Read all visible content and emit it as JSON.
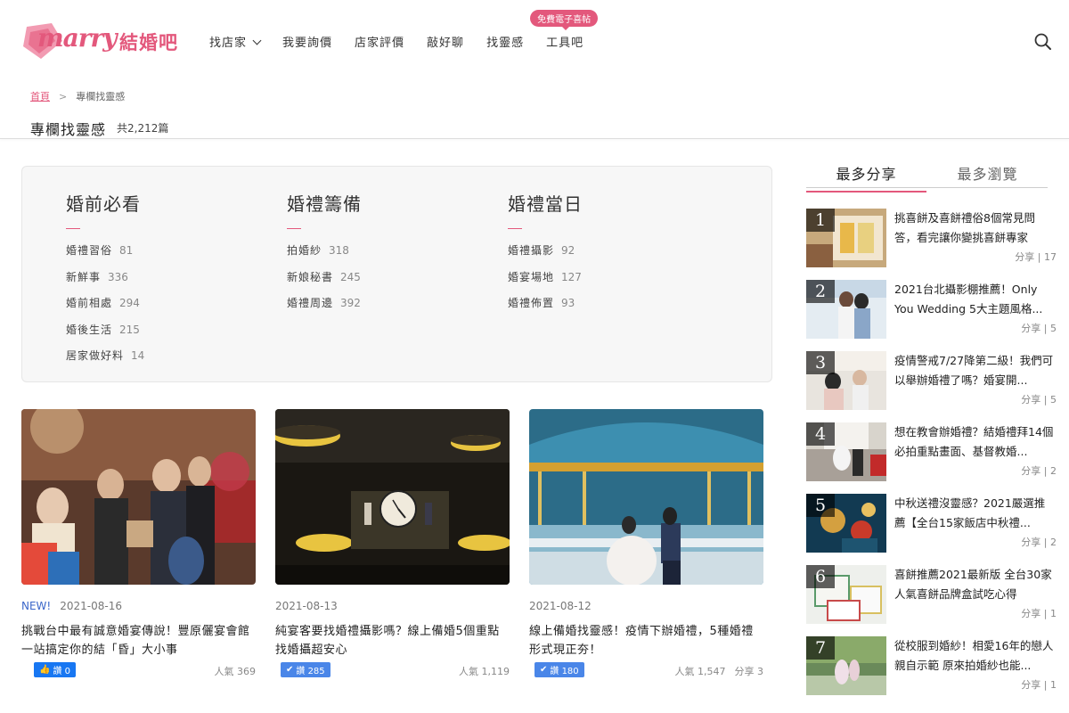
{
  "header": {
    "logo_script": "marry",
    "logo_cn": "結婚吧",
    "nav": [
      {
        "label": "找店家",
        "has_dropdown": true
      },
      {
        "label": "我要詢價"
      },
      {
        "label": "店家評價"
      },
      {
        "label": "敲好聊"
      },
      {
        "label": "找靈感"
      },
      {
        "label": "工具吧",
        "badge": "免費電子喜帖"
      }
    ]
  },
  "breadcrumb": {
    "home": "首頁",
    "separator": ">",
    "current": "專欄找靈感"
  },
  "page": {
    "title": "專欄找靈感",
    "count": "共2,212篇"
  },
  "categories": [
    {
      "heading": "婚前必看",
      "items": [
        {
          "label": "婚禮習俗",
          "count": "81"
        },
        {
          "label": "新鮮事",
          "count": "336"
        },
        {
          "label": "婚前相處",
          "count": "294"
        },
        {
          "label": "婚後生活",
          "count": "215"
        },
        {
          "label": "居家做好料",
          "count": "14"
        }
      ]
    },
    {
      "heading": "婚禮籌備",
      "items": [
        {
          "label": "拍婚紗",
          "count": "318"
        },
        {
          "label": "新娘秘書",
          "count": "245"
        },
        {
          "label": "婚禮周邊",
          "count": "392"
        }
      ]
    },
    {
      "heading": "婚禮當日",
      "items": [
        {
          "label": "婚禮攝影",
          "count": "92"
        },
        {
          "label": "婚宴場地",
          "count": "127"
        },
        {
          "label": "婚禮佈置",
          "count": "93"
        }
      ]
    }
  ],
  "articles": [
    {
      "new": "NEW!",
      "date": "2021-08-16",
      "title": "挑戰台中最有誠意婚宴傳說！豐原儷宴會館一站搞定你的結「昏」大小事",
      "like": "讚 0",
      "popularity": "人氣 369",
      "share": ""
    },
    {
      "new": "",
      "date": "2021-08-13",
      "title": "純宴客要找婚禮攝影嗎？線上備婚5個重點找婚攝超安心",
      "like": "讚 285",
      "popularity": "人氣 1,119",
      "share": ""
    },
    {
      "new": "",
      "date": "2021-08-12",
      "title": "線上備婚找靈感！疫情下辦婚禮，5種婚禮形式現正夯！",
      "like": "讚 180",
      "popularity": "人氣 1,547",
      "share": "分享 3"
    }
  ],
  "sidebar": {
    "tabs": [
      "最多分享",
      "最多瀏覽"
    ],
    "items": [
      {
        "rank": "1",
        "title": "挑喜餅及喜餅禮俗8個常見問答，看完讓你變挑喜餅專家",
        "share": "分享 | 17"
      },
      {
        "rank": "2",
        "title": "2021台北攝影棚推薦！Only You Wedding 5大主題風格...",
        "share": "分享 | 5"
      },
      {
        "rank": "3",
        "title": "疫情警戒7/27降第二級！我們可以舉辦婚禮了嗎？婚宴開...",
        "share": "分享 | 5"
      },
      {
        "rank": "4",
        "title": "想在教會辦婚禮？結婚禮拜14個必拍重點畫面、基督教婚...",
        "share": "分享 | 2"
      },
      {
        "rank": "5",
        "title": "中秋送禮沒靈感？2021嚴選推薦【全台15家飯店中秋禮...",
        "share": "分享 | 2"
      },
      {
        "rank": "6",
        "title": "喜餅推薦2021最新版 全台30家人氣喜餅品牌盒試吃心得",
        "share": "分享 | 1"
      },
      {
        "rank": "7",
        "title": "從校服到婚紗！相愛16年的戀人親自示範 原來拍婚紗也能...",
        "share": "分享 | 1"
      }
    ]
  },
  "colors": {
    "brand": "#e3587c",
    "fb_blue": "#1877f2",
    "like_blue": "#4a86e8"
  }
}
